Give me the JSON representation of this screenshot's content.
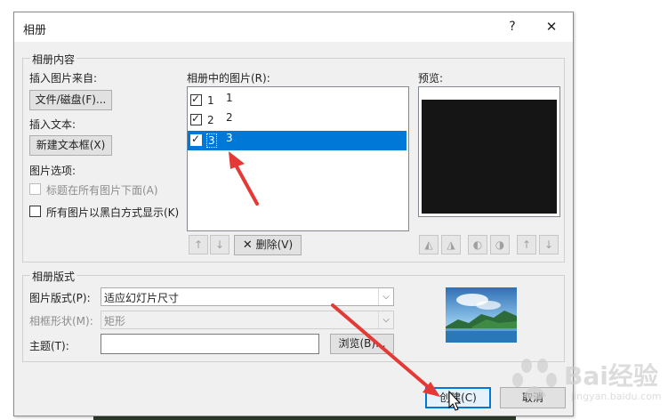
{
  "dialog": {
    "title": "相册",
    "help_label": "?",
    "close_label": "✕"
  },
  "content_group": {
    "label": "相册内容",
    "insert_picture_from": "插入图片来自:",
    "file_disk_button": "文件/磁盘(F)...",
    "insert_text": "插入文本:",
    "new_textbox_button": "新建文本框(X)",
    "picture_options": "图片选项:",
    "captions_below": "标题在所有图片下面(A)",
    "black_and_white": "所有图片以黑白方式显示(K)"
  },
  "pictures_in_album": {
    "label": "相册中的图片(R):",
    "items": [
      {
        "num": "1",
        "name": "1",
        "checked": true,
        "selected": false
      },
      {
        "num": "2",
        "name": "2",
        "checked": true,
        "selected": false
      },
      {
        "num": "3",
        "name": "3",
        "checked": true,
        "selected": true
      }
    ],
    "move_up_icon": "arrow-up-icon",
    "move_down_icon": "arrow-down-icon",
    "delete_button": "删除(V)"
  },
  "preview": {
    "label": "预览:",
    "tools": [
      "rotate-left-icon",
      "rotate-right-icon",
      "contrast-up-icon",
      "contrast-down-icon",
      "brightness-up-icon",
      "brightness-down-icon"
    ]
  },
  "layout_group": {
    "label": "相册版式",
    "picture_layout_label": "图片版式(P):",
    "picture_layout_value": "适应幻灯片尺寸",
    "frame_shape_label": "相框形状(M):",
    "frame_shape_value": "矩形",
    "theme_label": "主题(T):",
    "theme_value": "",
    "browse_button": "浏览(B)..."
  },
  "footer": {
    "create_button": "创建(C)",
    "cancel_button": "取消"
  },
  "watermark": {
    "text": "Bai经验",
    "sub": "jingyan.baidu.com"
  },
  "colors": {
    "selection": "#0078d7",
    "annotation_arrow": "#e53935"
  }
}
